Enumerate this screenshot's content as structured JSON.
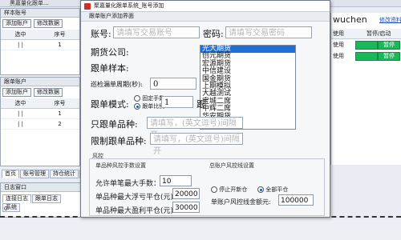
{
  "main_window": {
    "title": "黑嘉量化跟单…",
    "left_panel": {
      "header": "样本账号",
      "buttons": [
        "添加账户",
        "修改数据"
      ],
      "columns": [
        "选中",
        "序号"
      ],
      "rows": [
        [
          "| |",
          "1"
        ]
      ]
    },
    "left_panel2": {
      "header": "跟单账户",
      "buttons": [
        "添加账户",
        "修改数据"
      ],
      "columns": [
        "选中",
        "序号"
      ],
      "rows": [
        [
          "| |",
          "1"
        ],
        [
          "| |",
          "2"
        ]
      ]
    },
    "right_panel": {
      "user": "wuchen",
      "modify_link": "修改资料",
      "columns": [
        "使用",
        "暂停/启动"
      ],
      "rows": [
        [
          "使用",
          "暂停"
        ],
        [
          "使用",
          "暂停"
        ]
      ]
    },
    "tabs": [
      "首页",
      "账号管理",
      "持仓统计",
      "成"
    ],
    "log_window": {
      "title": "日志窗口",
      "tabs": [
        "连接日志",
        "跟单日志",
        "系统"
      ]
    },
    "status_text": "0"
  },
  "dialog": {
    "title": "聚嘉量化跟单系统_账号添加",
    "section_header": "跟单账户添加界面",
    "account_label": "账号:",
    "account_placeholder": "请填写交易账号",
    "password_label": "密码:",
    "password_placeholder": "请填写交易密码",
    "company_label": "期货公司:",
    "company_selected": "光大期货",
    "company_options": [
      "光大期货",
      "创元期货",
      "宏源期货",
      "中信建设",
      "国金期货",
      "上期模拟",
      "大越测试",
      "宝城二席",
      "中辉二席",
      "华安期货"
    ],
    "sample_label": "跟单样本:",
    "interval_label": "巡检漏单周期(秒):",
    "interval_value": "0",
    "mode_label": "跟单模式:",
    "mode_fixed": "固定手数",
    "mode_ratio": "跟单比例",
    "mode_value": "1",
    "mode_suffix": "跟",
    "only_label": "只跟单品种:",
    "only_placeholder": "请填写，(英文逗号)间隔开",
    "limit_label": "限制跟单品种:",
    "limit_placeholder": "请填写，(英文逗号)间隔开",
    "risk_title": "风控",
    "product_risk_title": "单品种风控手数设置",
    "max_lots_label": "允许单笔最大手数：",
    "max_lots_value": "10",
    "max_loss_label": "单品种最大浮亏平仓(元):",
    "max_loss_value": "20000",
    "max_profit_label": "单品种最大盈利平仓(元):",
    "max_profit_value": "30000",
    "account_risk_title": "总账户风控线设置",
    "stop_open": "停止开新仓",
    "close_all": "全部平仓",
    "account_line_label": "单账户风控线金额元:",
    "account_line_value": "100000"
  },
  "colors": {
    "accent_green": "#19b95a",
    "select_blue": "#1e6fd6",
    "logo_red": "#d42c2c"
  }
}
